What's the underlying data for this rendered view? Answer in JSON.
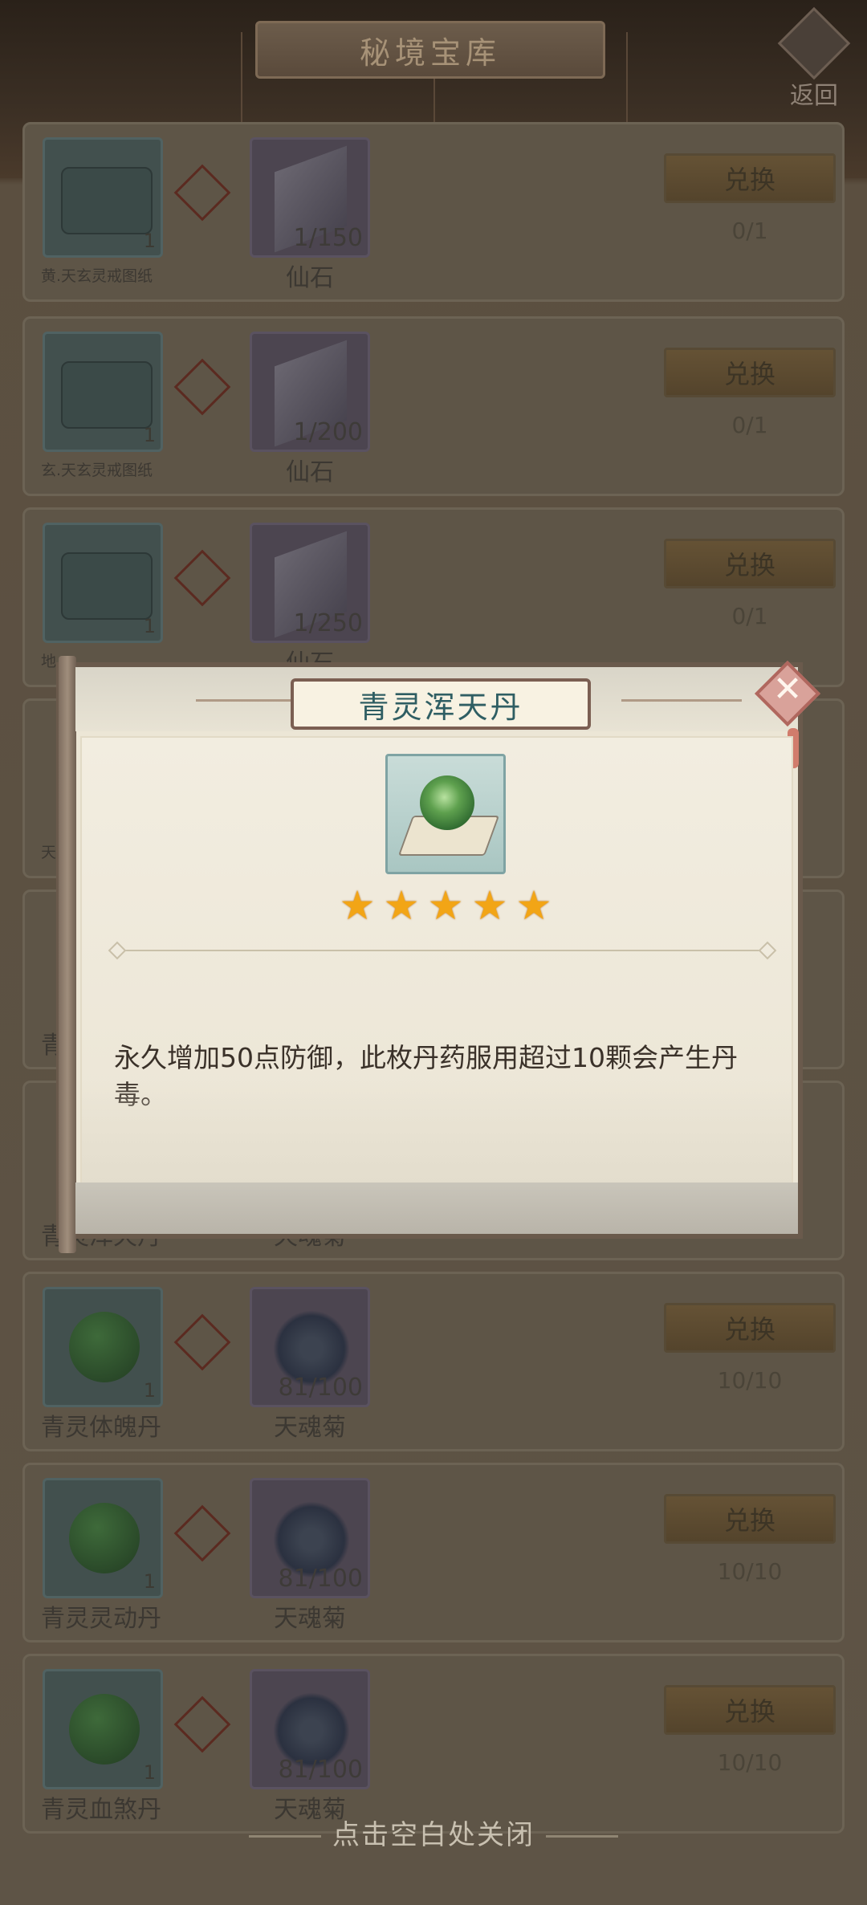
{
  "header": {
    "title": "秘境宝库",
    "back_label": "返回"
  },
  "rows": [
    {
      "reward_name": "黄.天玄灵戒图纸",
      "reward_count": "1",
      "cost_name": "仙石",
      "cost_count": "1/150",
      "button": "兑换",
      "limit": "0/1"
    },
    {
      "reward_name": "玄.天玄灵戒图纸",
      "reward_count": "1",
      "cost_name": "仙石",
      "cost_count": "1/200",
      "button": "兑换",
      "limit": "0/1"
    },
    {
      "reward_name": "地",
      "reward_count": "1",
      "cost_name": "仙石",
      "cost_count": "1/250",
      "button": "兑换",
      "limit": "0/1"
    },
    {
      "reward_name": "天",
      "reward_count": "",
      "cost_name": "",
      "cost_count": "",
      "button": "",
      "limit": ""
    },
    {
      "reward_name": "青",
      "reward_count": "",
      "cost_name": "",
      "cost_count": "",
      "button": "",
      "limit": ""
    },
    {
      "reward_name": "青灵浑天丹",
      "reward_count": "",
      "cost_name": "天魂菊",
      "cost_count": "",
      "button": "",
      "limit": ""
    },
    {
      "reward_name": "青灵体魄丹",
      "reward_count": "1",
      "cost_name": "天魂菊",
      "cost_count": "81/100",
      "button": "兑换",
      "limit": "10/10"
    },
    {
      "reward_name": "青灵灵动丹",
      "reward_count": "1",
      "cost_name": "天魂菊",
      "cost_count": "81/100",
      "button": "兑换",
      "limit": "10/10"
    },
    {
      "reward_name": "青灵血煞丹",
      "reward_count": "1",
      "cost_name": "天魂菊",
      "cost_count": "81/100",
      "button": "兑换",
      "limit": "10/10"
    }
  ],
  "modal": {
    "title": "青灵浑天丹",
    "stars": 5,
    "star_glyph": "★",
    "description": "永久增加50点防御，此枚丹药服用超过10颗会产生丹毒。",
    "close_glyph": "✕"
  },
  "footer_hint": "点击空白处关闭",
  "colors": {
    "title_teal": "#2f5e63",
    "star_gold": "#f2a516",
    "close_pink": "#d9a29a"
  }
}
